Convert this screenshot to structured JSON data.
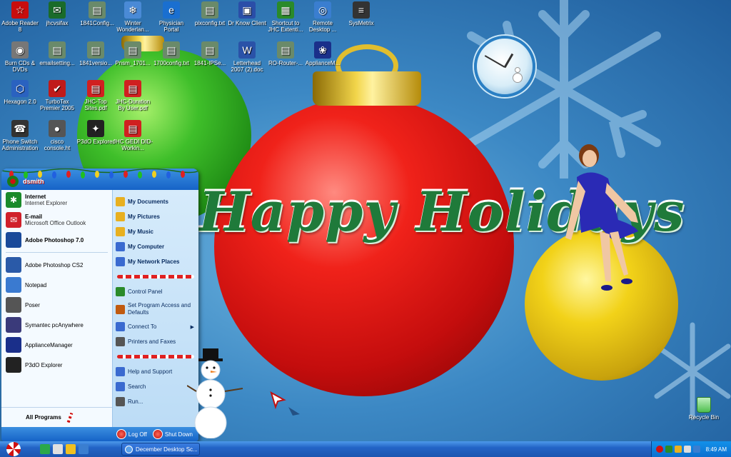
{
  "desktop": {
    "icons": [
      {
        "label": "Adobe Reader 8",
        "glyph": "☆",
        "color": "#c80d0d"
      },
      {
        "label": "jhcvsifax",
        "glyph": "✉",
        "color": "#1a6b2a"
      },
      {
        "label": "1841Config...",
        "glyph": "▤",
        "color": "#6a8a6a"
      },
      {
        "label": "Winter Wonderlan...",
        "glyph": "❄",
        "color": "#4a8ad6"
      },
      {
        "label": "Physician Portal",
        "glyph": "e",
        "color": "#1a6fd0"
      },
      {
        "label": "pixconfig.txt",
        "glyph": "▤",
        "color": "#6a8a6a"
      },
      {
        "label": "Dr Know Client",
        "glyph": "▣",
        "color": "#2a4ea8"
      },
      {
        "label": "Shortcut to JHC Extenti...",
        "glyph": "▦",
        "color": "#2a8a2a"
      },
      {
        "label": "Remote Desktop ...",
        "glyph": "◎",
        "color": "#3a7ed0"
      },
      {
        "label": "SysMetrix",
        "glyph": "≡",
        "color": "#333333"
      },
      {
        "label": "Burn CDs & DVDs",
        "glyph": "◉",
        "color": "#777777"
      },
      {
        "label": "emailsetting...",
        "glyph": "▤",
        "color": "#6a8a6a"
      },
      {
        "label": "1841versio...",
        "glyph": "▤",
        "color": "#6a8a6a"
      },
      {
        "label": "Pnsm_1701...",
        "glyph": "▤",
        "color": "#6a8a6a"
      },
      {
        "label": "1700config.txt",
        "glyph": "▤",
        "color": "#6a8a6a"
      },
      {
        "label": "1841-IPSe...",
        "glyph": "▤",
        "color": "#6a8a6a"
      },
      {
        "label": "Letterhead 2007 (2).doc",
        "glyph": "W",
        "color": "#2a52a8"
      },
      {
        "label": "RO-Router-...",
        "glyph": "▤",
        "color": "#6a8a6a"
      },
      {
        "label": "ApplianceM...",
        "glyph": "❀",
        "color": "#1a2f8a"
      },
      {
        "label": "Hexagon 2.0",
        "glyph": "⬡",
        "color": "#2a62c0"
      },
      {
        "label": "TurboTax Premier 2005",
        "glyph": "✔",
        "color": "#c01a1a"
      },
      {
        "label": "JHC-Top Sites.pdf",
        "glyph": "▤",
        "color": "#d02020"
      },
      {
        "label": "JHC-Duration By User.pdf",
        "glyph": "▤",
        "color": "#d02020"
      },
      {
        "label": "Phone Switch Administration",
        "glyph": "☎",
        "color": "#333333"
      },
      {
        "label": "cisco console.ht",
        "glyph": "●",
        "color": "#555555"
      },
      {
        "label": "P3dO Explorer",
        "glyph": "✦",
        "color": "#222222"
      },
      {
        "label": "JHC GEDI DID-Workin...",
        "glyph": "▤",
        "color": "#d02020"
      }
    ],
    "recycle_bin": "Recycle Bin",
    "greeting": "Happy Holidays"
  },
  "start_menu": {
    "user": "dsmith",
    "pinned": [
      {
        "title": "Internet",
        "subtitle": "Internet Explorer",
        "color": "#1a8a2a",
        "glyph": "✱"
      },
      {
        "title": "E-mail",
        "subtitle": "Microsoft Office Outlook",
        "color": "#d0202a",
        "glyph": "✉"
      }
    ],
    "recent": [
      {
        "label": "Adobe Photoshop 7.0",
        "bold": true,
        "color": "#1a4a9a"
      },
      {
        "label": "Adobe Photoshop CS2",
        "bold": false,
        "color": "#2a5aa8"
      },
      {
        "label": "Notepad",
        "bold": false,
        "color": "#3a7ad0"
      },
      {
        "label": "Poser",
        "bold": false,
        "color": "#555555"
      },
      {
        "label": "Symantec pcAnywhere",
        "bold": false,
        "color": "#3a3a7a"
      },
      {
        "label": "ApplianceManager",
        "bold": false,
        "color": "#1a2f8a"
      },
      {
        "label": "P3dO Explorer",
        "bold": false,
        "color": "#222222"
      }
    ],
    "all_programs": "All Programs",
    "right_top": [
      {
        "label": "My Documents",
        "color": "#e8b020"
      },
      {
        "label": "My Pictures",
        "color": "#e8b020"
      },
      {
        "label": "My Music",
        "color": "#e8b020"
      },
      {
        "label": "My Computer",
        "color": "#3a6ad0"
      },
      {
        "label": "My Network Places",
        "color": "#3a6ad0"
      }
    ],
    "right_middle": [
      {
        "label": "Control Panel",
        "color": "#2a8a2a"
      },
      {
        "label": "Set Program Access and Defaults",
        "color": "#c05a10"
      },
      {
        "label": "Connect To",
        "color": "#3a6ad0"
      },
      {
        "label": "Printers and Faxes",
        "color": "#555555"
      }
    ],
    "right_bottom": [
      {
        "label": "Help and Support",
        "color": "#3a6ad0"
      },
      {
        "label": "Search",
        "color": "#3a6ad0"
      },
      {
        "label": "Run...",
        "color": "#555555"
      }
    ],
    "log_off": "Log Off",
    "shut_down": "Shut Down"
  },
  "taskbar": {
    "task_label": "December Desktop Sc...",
    "clock": "8:49 AM"
  }
}
